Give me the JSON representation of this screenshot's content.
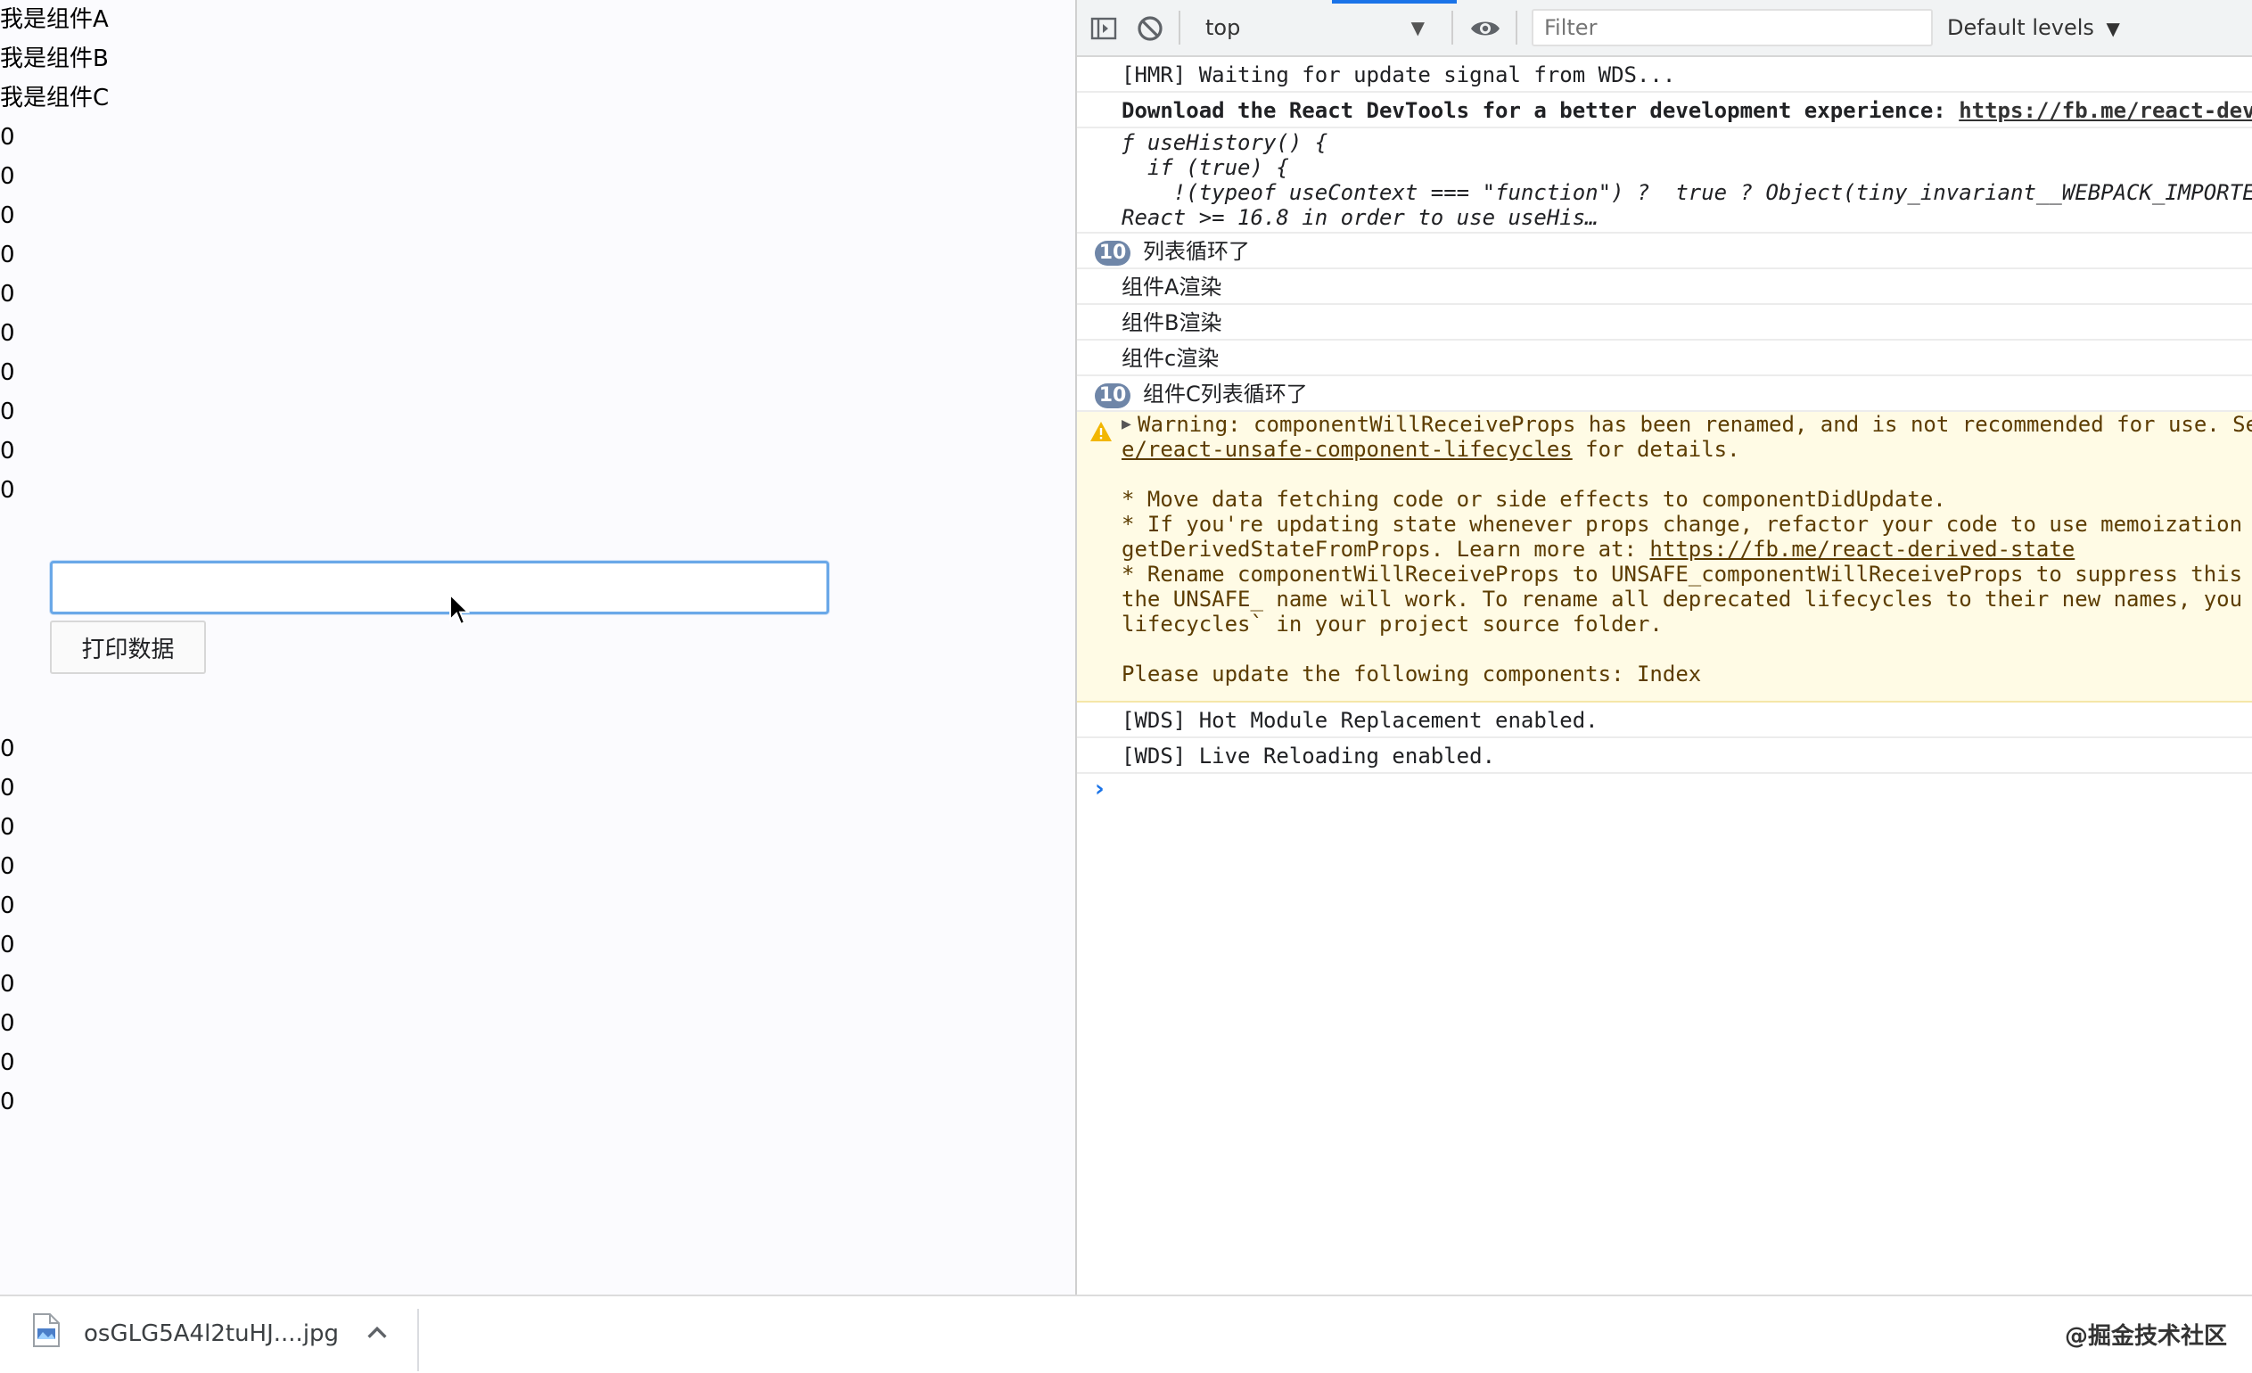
{
  "page": {
    "components": [
      "我是组件A",
      "我是组件B",
      "我是组件C"
    ],
    "list_top": [
      "0",
      "0",
      "0",
      "0",
      "0",
      "0",
      "0",
      "0",
      "0",
      "0"
    ],
    "input_value": "",
    "print_button_label": "打印数据",
    "list_bottom": [
      "0",
      "0",
      "0",
      "0",
      "0",
      "0",
      "0",
      "0",
      "0",
      "0"
    ]
  },
  "devtools": {
    "context": "top",
    "filter_placeholder": "Filter",
    "levels_label": "Default levels",
    "console": {
      "hmr": "[HMR] Waiting for update signal from WDS...",
      "react_devtools_text": "Download the React DevTools for a better development experience: ",
      "react_devtools_link": "https://fb.me/react-devtools",
      "use_history_lines": [
        "ƒ useHistory() {",
        "  if (true) {",
        "    !(typeof useContext === \"function\") ?  true ? Object(tiny_invariant__WEBPACK_IMPORTED",
        "React >= 16.8 in order to use useHis…"
      ],
      "group1_count": "10",
      "group1_text": "列表循环了",
      "render_a": "组件A渲染",
      "render_b": "组件B渲染",
      "render_c": "组件c渲染",
      "group2_count": "10",
      "group2_text": "组件C列表循环了",
      "warning_line1": "Warning: componentWillReceiveProps has been renamed, and is not recommended for use. See",
      "warning_link": "e/react-unsafe-component-lifecycles",
      "warning_link_suffix": " for details.",
      "warning_bullet1": "* Move data fetching code or side effects to componentDidUpdate.",
      "warning_bullet2": "* If you're updating state whenever props change, refactor your code to use memoization",
      "warning_bullet2b_text": "getDerivedStateFromProps. Learn more at: ",
      "warning_bullet2b_link": "https://fb.me/react-derived-state",
      "warning_bullet3": "* Rename componentWillReceiveProps to UNSAFE_componentWillReceiveProps to suppress this",
      "warning_bullet3b": "the UNSAFE_ name will work. To rename all deprecated lifecycles to their new names, you",
      "warning_bullet3c": "lifecycles` in your project source folder.",
      "warning_update": "Please update the following components: Index",
      "wds_hot": "[WDS] Hot Module Replacement enabled.",
      "wds_live": "[WDS] Live Reloading enabled.",
      "prompt": "›"
    }
  },
  "download_bar": {
    "file_name": "osGLG5A4l2tuHJ....jpg",
    "file_icon": "jpeg-file-icon",
    "watermark": "@掘金技术社区"
  },
  "colors": {
    "accent": "#1a73e8",
    "badge": "#6f86a8",
    "warning_bg": "#fffbe5",
    "warning_text": "#5c3c00"
  }
}
